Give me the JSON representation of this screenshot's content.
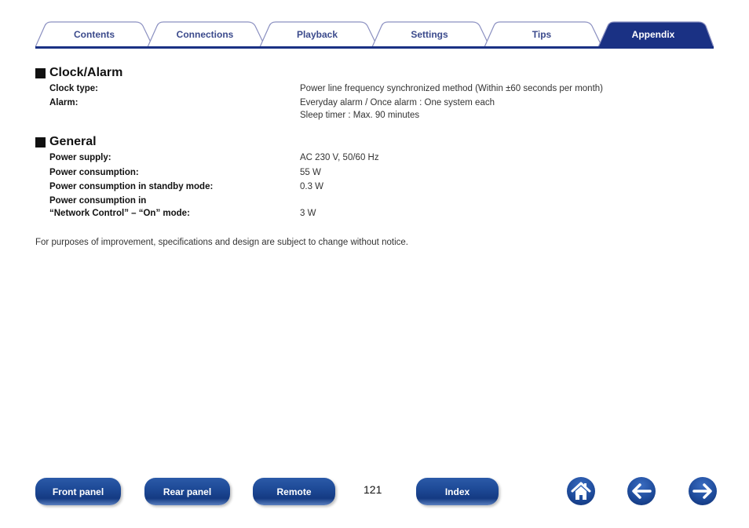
{
  "tabs": [
    {
      "label": "Contents",
      "active": false
    },
    {
      "label": "Connections",
      "active": false
    },
    {
      "label": "Playback",
      "active": false
    },
    {
      "label": "Settings",
      "active": false
    },
    {
      "label": "Tips",
      "active": false
    },
    {
      "label": "Appendix",
      "active": true
    }
  ],
  "colors": {
    "tab_text": "#3b4a8c",
    "tab_active_bg": "#1a3184",
    "tab_border": "#8a8fc0",
    "rule": "#1a3184",
    "button_blue": "#1e4a97"
  },
  "sections": {
    "clock": {
      "title": "Clock/Alarm",
      "rows": [
        {
          "label": "Clock type:",
          "value": [
            "Power line frequency synchronized method (Within ±60 seconds per month)"
          ]
        },
        {
          "label": "Alarm:",
          "value": [
            "Everyday alarm / Once alarm : One system each",
            "Sleep timer : Max. 90 minutes"
          ]
        }
      ]
    },
    "general": {
      "title": "General",
      "rows": [
        {
          "label": "Power supply:",
          "value": [
            "AC 230 V, 50/60 Hz"
          ]
        },
        {
          "label": "Power consumption:",
          "value": [
            "55 W"
          ]
        },
        {
          "label": "Power consumption in standby mode:",
          "value": [
            "0.3 W"
          ]
        },
        {
          "label": "Power consumption in",
          "label2": "“Network Control” – “On” mode:",
          "value": [
            "3 W"
          ]
        }
      ]
    }
  },
  "footnote": "For purposes of improvement, specifications and design are subject to change without notice.",
  "bottom_nav": {
    "front_panel": "Front panel",
    "rear_panel": "Rear panel",
    "remote": "Remote",
    "page_number": "121",
    "index": "Index",
    "home_icon": "home-icon",
    "back_icon": "arrow-left-icon",
    "forward_icon": "arrow-right-icon"
  }
}
